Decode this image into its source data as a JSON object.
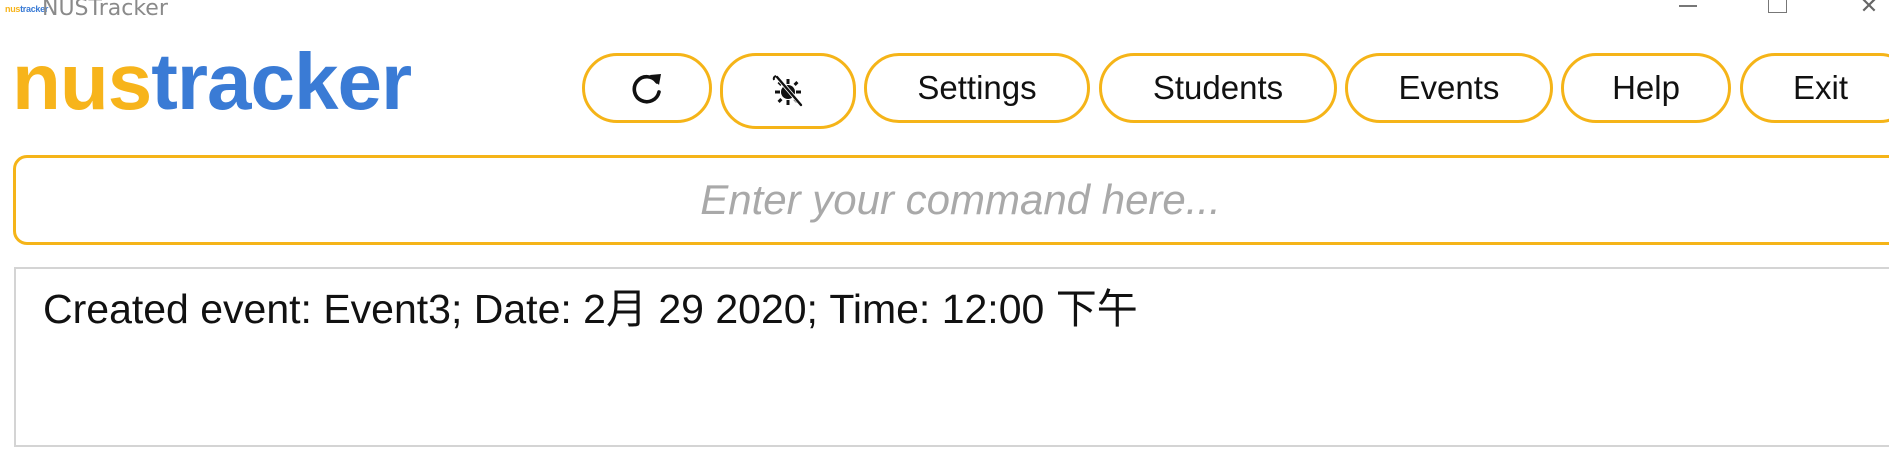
{
  "window": {
    "title": "NUSTracker",
    "icon_left": "nus",
    "icon_right": "tracker",
    "controls": {
      "minimize_icon": "minimize-icon",
      "maximize_icon": "maximize-icon",
      "close_icon": "close-icon",
      "close_glyph": "✕"
    }
  },
  "logo": {
    "part1": "nus",
    "part2": "tracker"
  },
  "toolbar": {
    "refresh_icon": "refresh-icon",
    "theme_icon": "theme-toggle-icon",
    "settings_label": "Settings",
    "students_label": "Students",
    "events_label": "Events",
    "help_label": "Help",
    "exit_label": "Exit"
  },
  "command": {
    "value": "",
    "placeholder": "Enter your command here..."
  },
  "result": {
    "message": "Created event: Event3; Date: 2月 29 2020; Time: 12:00 下午"
  },
  "colors": {
    "accent_yellow": "#f5b418",
    "brand_blue": "#3a7bd5",
    "placeholder_gray": "#a9a9a9",
    "result_border": "#d4d4d4"
  }
}
